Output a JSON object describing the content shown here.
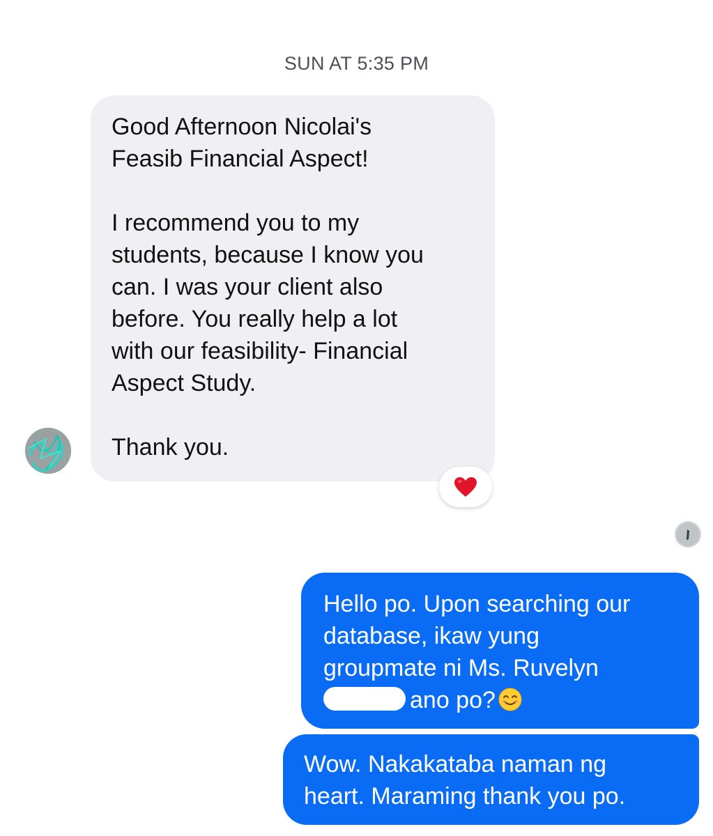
{
  "conversation": {
    "timestamp": "SUN AT 5:35 PM",
    "incoming": {
      "paragraph_1": [
        "Good Afternoon Nicolai's",
        "Feasib Financial Aspect!"
      ],
      "paragraph_2": [
        "I recommend you to my",
        "students, because I know you",
        "can. I was your client also",
        "before. You really help a lot",
        "with our feasibility- Financial",
        "Aspect Study."
      ],
      "paragraph_3": [
        "Thank you."
      ],
      "reaction_icon": "red-heart",
      "reaction_color": "#e0142a"
    },
    "outgoing": [
      {
        "lines": [
          "Hello po. Upon searching our",
          "database, ikaw yung",
          "groupmate ni Ms. Ruvelyn",
          "ano po?"
        ],
        "emoji": "smiling-face-with-smiling-eyes"
      },
      {
        "lines": [
          "Wow. Nakakataba naman ng",
          "heart. Maraming thank you po."
        ]
      }
    ],
    "colors": {
      "outgoing_bubble": "#0a6cf5",
      "incoming_bubble": "#f0f0f4",
      "timestamp_text": "#4b4f56"
    }
  }
}
